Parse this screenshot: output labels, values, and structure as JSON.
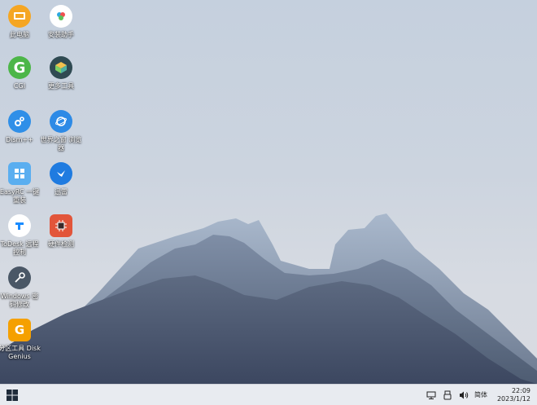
{
  "desktop": {
    "icons": [
      {
        "label": "此电脑",
        "icon": "this-pc-icon",
        "color": "#f5a623"
      },
      {
        "label": "安装助手",
        "icon": "install-assistant-icon",
        "color": "#ffffff"
      },
      {
        "label": "CGI",
        "icon": "cgi-backup-icon",
        "color": "#4cb648"
      },
      {
        "label": "更多工具",
        "icon": "more-tools-icon",
        "color": "#2f4a52"
      },
      {
        "label": "Dism++",
        "icon": "dism-icon",
        "color": "#2f8fe8"
      },
      {
        "label": "世界之窗 浏览器",
        "icon": "browser-icon",
        "color": "#2d8ae6"
      },
      {
        "label": "EasyRC 一键重装",
        "icon": "easyrc-icon",
        "color": "#5aaef0"
      },
      {
        "label": "迅雷",
        "icon": "thunder-icon",
        "color": "#1f7be0"
      },
      {
        "label": "ToDesk 远程控制",
        "icon": "todesk-icon",
        "color": "#ffffff"
      },
      {
        "label": "硬件检测",
        "icon": "hardware-check-icon",
        "color": "#e2553a"
      },
      {
        "label": "Windows 密码修改",
        "icon": "windows-password-icon",
        "color": "#4a5766"
      },
      {
        "label": "分区工具 DiskGenius",
        "icon": "diskgenius-icon",
        "color": "#f5a000"
      }
    ]
  },
  "taskbar": {
    "start_icon": "windows-start-icon",
    "tray_icons": [
      "network-icon",
      "usb-icon",
      "volume-icon"
    ],
    "ime": "简体",
    "time": "22:09",
    "date": "2023/1/12"
  }
}
